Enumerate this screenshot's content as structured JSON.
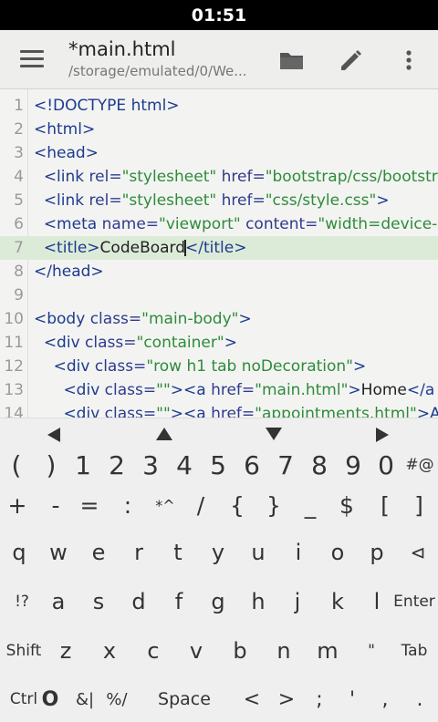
{
  "status_bar": {
    "time": "01:51"
  },
  "toolbar": {
    "title": "*main.html",
    "path": "/storage/emulated/0/We...",
    "icons": [
      "menu-icon",
      "folder-icon",
      "pencil-icon",
      "more-vert-icon"
    ]
  },
  "editor": {
    "line_numbers": [
      "1",
      "2",
      "3",
      "4",
      "5",
      "6",
      "7",
      "8",
      "9",
      "10",
      "11",
      "12",
      "13",
      "14"
    ],
    "highlighted_line": 7,
    "colors": {
      "tag": "#1d3a8f",
      "string": "#2e8b3a",
      "highlight": "#dcebd8"
    },
    "lines": [
      [
        {
          "t": "tag",
          "v": "<!DOCTYPE html>"
        }
      ],
      [
        {
          "t": "tag",
          "v": "<html>"
        }
      ],
      [
        {
          "t": "tag",
          "v": "<head>"
        }
      ],
      [
        {
          "t": "txt",
          "v": "  "
        },
        {
          "t": "tag",
          "v": "<link "
        },
        {
          "t": "attr",
          "v": "rel="
        },
        {
          "t": "str",
          "v": "\"stylesheet\""
        },
        {
          "t": "attr",
          "v": " href="
        },
        {
          "t": "str",
          "v": "\"bootstrap/css/bootstr"
        }
      ],
      [
        {
          "t": "txt",
          "v": "  "
        },
        {
          "t": "tag",
          "v": "<link "
        },
        {
          "t": "attr",
          "v": "rel="
        },
        {
          "t": "str",
          "v": "\"stylesheet\""
        },
        {
          "t": "attr",
          "v": " href="
        },
        {
          "t": "str",
          "v": "\"css/style.css\""
        },
        {
          "t": "tag",
          "v": ">"
        }
      ],
      [
        {
          "t": "txt",
          "v": "  "
        },
        {
          "t": "tag",
          "v": "<meta "
        },
        {
          "t": "attr",
          "v": "name="
        },
        {
          "t": "str",
          "v": "\"viewport\""
        },
        {
          "t": "attr",
          "v": " content="
        },
        {
          "t": "str",
          "v": "\"width=device-w"
        }
      ],
      [
        {
          "t": "txt",
          "v": "  "
        },
        {
          "t": "tag",
          "v": "<title>"
        },
        {
          "t": "txt",
          "v": "CodeBoard"
        },
        {
          "t": "cursor",
          "v": ""
        },
        {
          "t": "tag",
          "v": "</title>"
        }
      ],
      [
        {
          "t": "tag",
          "v": "</head>"
        }
      ],
      [],
      [
        {
          "t": "tag",
          "v": "<body "
        },
        {
          "t": "attr",
          "v": "class="
        },
        {
          "t": "str",
          "v": "\"main-body\""
        },
        {
          "t": "tag",
          "v": ">"
        }
      ],
      [
        {
          "t": "txt",
          "v": "  "
        },
        {
          "t": "tag",
          "v": "<div "
        },
        {
          "t": "attr",
          "v": "class="
        },
        {
          "t": "str",
          "v": "\"container\""
        },
        {
          "t": "tag",
          "v": ">"
        }
      ],
      [
        {
          "t": "txt",
          "v": "    "
        },
        {
          "t": "tag",
          "v": "<div "
        },
        {
          "t": "attr",
          "v": "class="
        },
        {
          "t": "str",
          "v": "\"row h1 tab noDecoration\""
        },
        {
          "t": "tag",
          "v": ">"
        }
      ],
      [
        {
          "t": "txt",
          "v": "      "
        },
        {
          "t": "tag",
          "v": "<div "
        },
        {
          "t": "attr",
          "v": "class="
        },
        {
          "t": "str",
          "v": "\"\""
        },
        {
          "t": "tag",
          "v": "><a "
        },
        {
          "t": "attr",
          "v": "href="
        },
        {
          "t": "str",
          "v": "\"main.html\""
        },
        {
          "t": "tag",
          "v": ">"
        },
        {
          "t": "txt",
          "v": "Home"
        },
        {
          "t": "tag",
          "v": "</a"
        }
      ],
      [
        {
          "t": "txt",
          "v": "      "
        },
        {
          "t": "tag",
          "v": "<div "
        },
        {
          "t": "attr",
          "v": "class="
        },
        {
          "t": "str",
          "v": "\"\""
        },
        {
          "t": "tag",
          "v": "><a "
        },
        {
          "t": "attr",
          "v": "href="
        },
        {
          "t": "str",
          "v": "\"appointments.html\""
        },
        {
          "t": "tag",
          "v": ">A"
        }
      ]
    ]
  },
  "keyboard": {
    "arrows": [
      "left-arrow",
      "up-arrow",
      "down-arrow",
      "right-arrow"
    ],
    "rows": [
      [
        "(",
        ")",
        "1",
        "2",
        "3",
        "4",
        "5",
        "6",
        "7",
        "8",
        "9",
        "0",
        "#@"
      ],
      [
        "+",
        "-",
        "=",
        ":",
        "*^",
        "/",
        "{",
        "}",
        "_",
        "$",
        "[",
        "]"
      ],
      [
        "q",
        "w",
        "e",
        "r",
        "t",
        "y",
        "u",
        "i",
        "o",
        "p",
        "⊲"
      ],
      [
        "!?",
        "a",
        "s",
        "d",
        "f",
        "g",
        "h",
        "j",
        "k",
        "l",
        "Enter"
      ],
      [
        "Shift",
        "z",
        "x",
        "c",
        "v",
        "b",
        "n",
        "m",
        "\"",
        "Tab"
      ],
      [
        "Ctrl",
        "O",
        "&|",
        "%/",
        "Space",
        "<",
        ">",
        ";",
        "'",
        ",",
        "."
      ]
    ]
  }
}
